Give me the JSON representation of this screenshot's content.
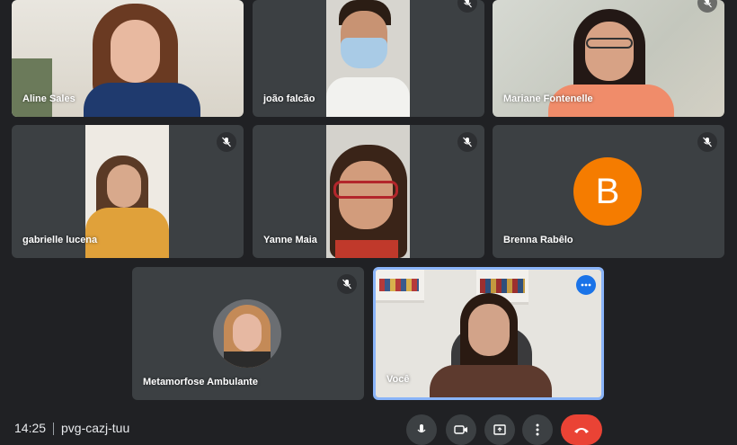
{
  "participants": [
    {
      "name": "Aline Sales",
      "muted": false
    },
    {
      "name": "joão falcão",
      "muted": true
    },
    {
      "name": "Mariane Fontenelle",
      "muted": true
    },
    {
      "name": "gabrielle lucena",
      "muted": true
    },
    {
      "name": "Yanne Maia",
      "muted": true
    },
    {
      "name": "Brenna Rabêlo",
      "muted": true,
      "avatar_letter": "B",
      "avatar_color": "#f57c00"
    },
    {
      "name": "Metamorfose Ambulante",
      "muted": true
    },
    {
      "name": "Você",
      "muted": false,
      "is_self": true
    }
  ],
  "meeting": {
    "time": "14:25",
    "code": "pvg-cazj-tuu"
  },
  "colors": {
    "background": "#202124",
    "tile": "#3c4043",
    "self_highlight": "#8ab4f8",
    "end_call": "#ea4335"
  }
}
